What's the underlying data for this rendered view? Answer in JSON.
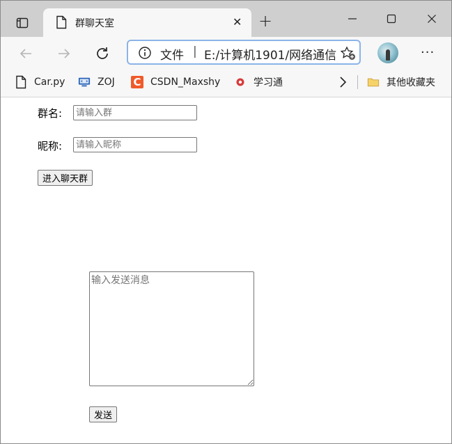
{
  "tab": {
    "title": "群聊天室",
    "close": "✕"
  },
  "newtab": "+",
  "address": {
    "scheme": "文件",
    "separator": "|",
    "url": "E:/计算机1901/网络通信"
  },
  "more": "···",
  "bookmarks": [
    {
      "label": "Car.py",
      "icon": "file-icon"
    },
    {
      "label": "ZOJ",
      "icon": "zoj-icon"
    },
    {
      "label": "CSDN_Maxshy",
      "icon": "csdn-icon"
    },
    {
      "label": "学习通",
      "icon": "xuexitong-icon"
    }
  ],
  "other_bookmarks": "其他收藏夹",
  "form": {
    "group_label": "群名:",
    "group_placeholder": "请输入群",
    "nick_label": "昵称:",
    "nick_placeholder": "请输入昵称",
    "enter_button": "进入聊天群"
  },
  "message": {
    "placeholder": "输入发送消息",
    "send_button": "发送"
  }
}
